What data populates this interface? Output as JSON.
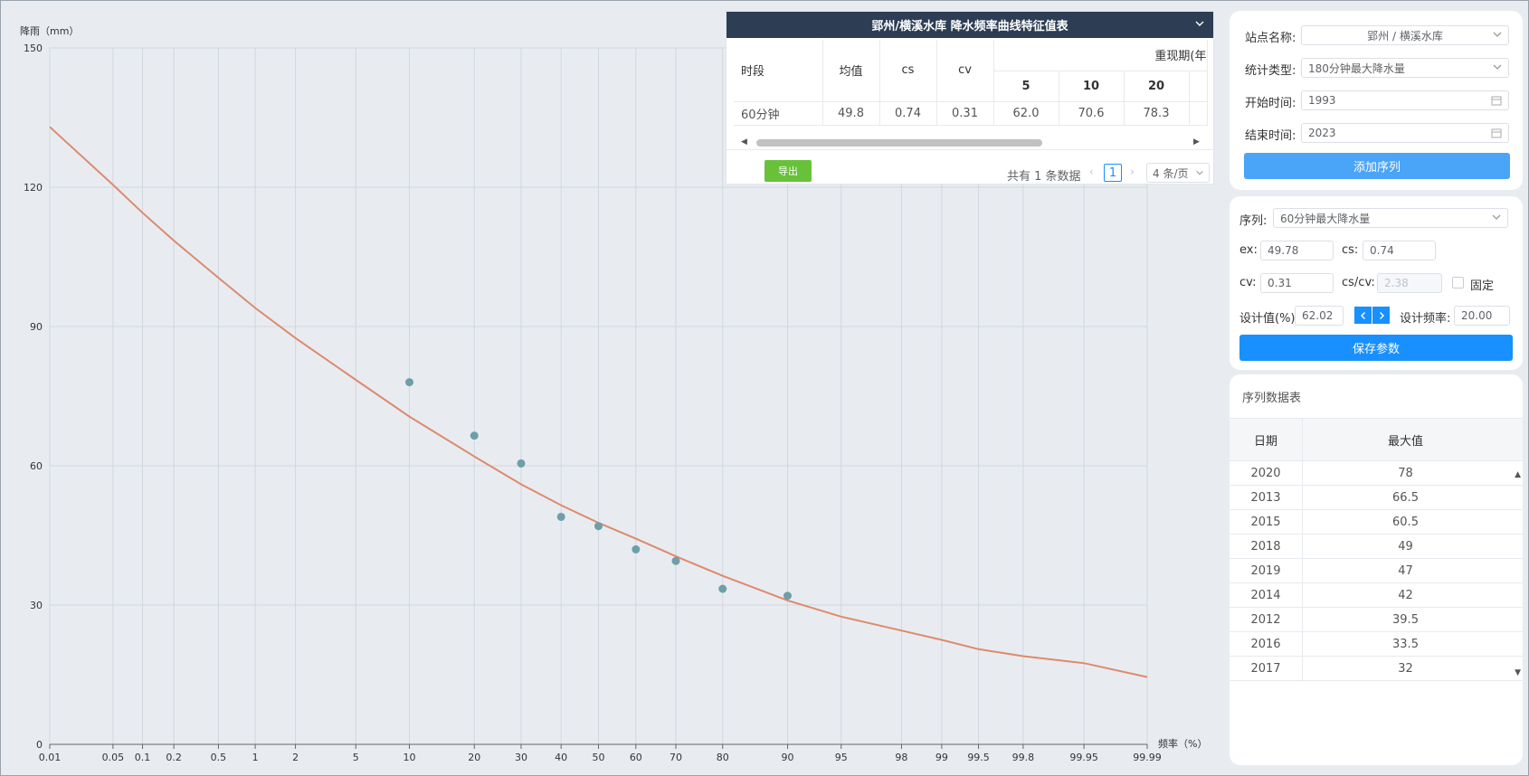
{
  "chart_data": {
    "type": "scatter",
    "ylabel": "降雨（mm）",
    "xlabel": "频率（%）",
    "ylim": [
      0,
      150
    ],
    "y_ticks": [
      0,
      30,
      60,
      90,
      120,
      150
    ],
    "x_ticks": [
      "0.01",
      "0.05",
      "0.1",
      "0.2",
      "0.5",
      "1",
      "2",
      "5",
      "10",
      "20",
      "30",
      "40",
      "50",
      "60",
      "70",
      "80",
      "90",
      "95",
      "98",
      "99",
      "99.5",
      "99.8",
      "99.95",
      "99.99"
    ],
    "x_scale": "probability",
    "grid": true,
    "series": [
      {
        "type": "points",
        "x": [
          10,
          20,
          30,
          40,
          50,
          60,
          70,
          80,
          90
        ],
        "y": [
          78,
          66.5,
          60.5,
          49,
          47,
          42,
          39.5,
          33.5,
          32
        ]
      },
      {
        "type": "line",
        "x": [
          0.01,
          0.05,
          0.1,
          0.2,
          0.5,
          1,
          2,
          5,
          10,
          20,
          30,
          40,
          50,
          60,
          70,
          80,
          90,
          95,
          98,
          99,
          99.5,
          99.8,
          99.95,
          99.99
        ],
        "y": [
          133,
          120.5,
          114.5,
          108.5,
          100.5,
          94,
          87.5,
          78.5,
          70.6,
          62,
          56,
          51.5,
          47.7,
          44.3,
          40.5,
          36.3,
          31,
          27.5,
          24.5,
          22.5,
          20.5,
          19,
          17.5,
          14.5
        ]
      }
    ],
    "colors": {
      "points": "#6e9fa8",
      "curve": "#de8a6c",
      "grid": "#d2d7de"
    }
  },
  "stats": {
    "title": "郢州/横溪水库 降水频率曲线特征值表",
    "headers": {
      "period": "时段",
      "mean": "均值",
      "cs": "cs",
      "cv": "cv",
      "return_group": "重现期(年"
    },
    "return_periods": [
      "5",
      "10",
      "20"
    ],
    "rows": [
      {
        "period": "60分钟",
        "mean": "49.8",
        "cs": "0.74",
        "cv": "0.31",
        "vals": [
          "62.0",
          "70.6",
          "78.3"
        ]
      }
    ],
    "export_label": "导出",
    "total_text": "共有 1 条数据",
    "page": "1",
    "page_size": "4 条/页"
  },
  "query": {
    "station_label": "站点名称:",
    "station_value": "郢州 / 横溪水库",
    "type_label": "统计类型:",
    "type_value": "180分钟最大降水量",
    "start_label": "开始时间:",
    "start_value": "1993",
    "end_label": "结束时间:",
    "end_value": "2023",
    "add_button": "添加序列"
  },
  "params": {
    "series_label": "序列:",
    "series_value": "60分钟最大降水量",
    "ex_label": "ex:",
    "ex_value": "49.78",
    "cs_label": "cs:",
    "cs_value": "0.74",
    "cv_label": "cv:",
    "cv_value": "0.31",
    "cscv_label": "cs/cv:",
    "cscv_value": "2.38",
    "fixed_label": "固定",
    "design_value_label": "设计值(%):",
    "design_value": "62.02",
    "design_freq_label": "设计频率:",
    "design_freq": "20.00",
    "save_button": "保存参数"
  },
  "seq_table": {
    "title": "序列数据表",
    "headers": [
      "日期",
      "最大值"
    ],
    "rows": [
      [
        "2020",
        "78"
      ],
      [
        "2013",
        "66.5"
      ],
      [
        "2015",
        "60.5"
      ],
      [
        "2018",
        "49"
      ],
      [
        "2019",
        "47"
      ],
      [
        "2014",
        "42"
      ],
      [
        "2012",
        "39.5"
      ],
      [
        "2016",
        "33.5"
      ],
      [
        "2017",
        "32"
      ]
    ]
  }
}
